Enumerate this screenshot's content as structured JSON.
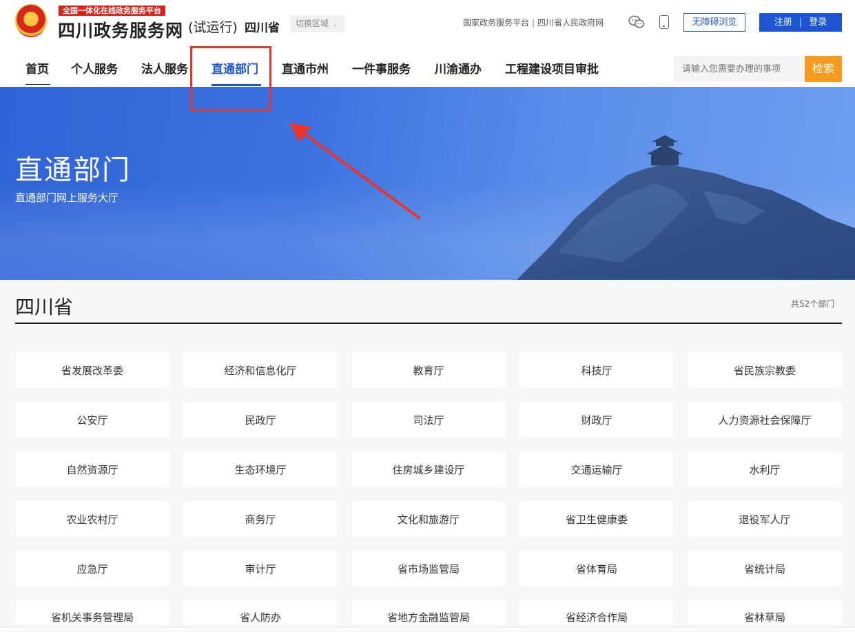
{
  "header": {
    "gov_tag": "全国一体化在线政务服务平台",
    "site_name": "四川政务服务网",
    "trial_label": "(试运行)",
    "province": "四川省",
    "switch_region": "切换区域",
    "top_links": [
      "国家政务服务平台",
      "四川省人民政府网"
    ],
    "accessible_label": "无障碍浏览",
    "register_label": "注册",
    "login_label": "登录"
  },
  "nav": {
    "items": [
      "首页",
      "个人服务",
      "法人服务",
      "直通部门",
      "直通市州",
      "一件事服务",
      "川渝通办",
      "工程建设项目审批"
    ],
    "active": "直通部门"
  },
  "search": {
    "placeholder": "请输入您需要办理的事项",
    "button_label": "检索"
  },
  "banner": {
    "title": "直通部门",
    "subtitle": "直通部门网上服务大厅"
  },
  "section": {
    "title": "四川省",
    "count": "共52个部门"
  },
  "departments": [
    "省发展改革委",
    "经济和信息化厅",
    "教育厅",
    "科技厅",
    "省民族宗教委",
    "公安厅",
    "民政厅",
    "司法厅",
    "财政厅",
    "人力资源社会保障厅",
    "自然资源厅",
    "生态环境厅",
    "住房城乡建设厅",
    "交通运输厅",
    "水利厅",
    "农业农村厅",
    "商务厅",
    "文化和旅游厅",
    "省卫生健康委",
    "退役军人厅",
    "应急厅",
    "审计厅",
    "省市场监管局",
    "省体育局",
    "省统计局",
    "省机关事务管理局",
    "省人防办",
    "省地方金融监管局",
    "省经济合作局",
    "省林草局"
  ],
  "colors": {
    "primary": "#1c56d3",
    "search_button": "#f79a1e",
    "annotation": "#e8342a",
    "gov_red": "#d9261c"
  }
}
